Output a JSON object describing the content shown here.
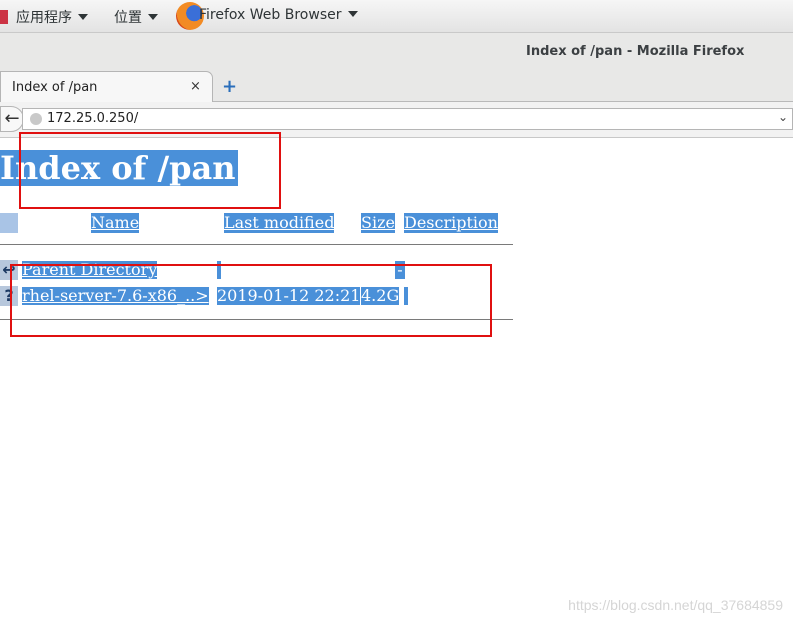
{
  "topbar": {
    "applications": "应用程序",
    "places": "位置",
    "app_name": "Firefox Web Browser"
  },
  "window": {
    "title": "Index of /pan - Mozilla Firefox"
  },
  "tab": {
    "label": "Index of /pan",
    "close": "×",
    "new_tab": "+"
  },
  "navbar": {
    "back": "←",
    "url": "172.25.0.250/",
    "url_dropdown": "⌄"
  },
  "page": {
    "heading": "Index of /pan",
    "columns": [
      "Name",
      "Last modified",
      "Size",
      "Description"
    ],
    "rows": [
      {
        "icon": "↩",
        "icon_name": "back-folder-icon",
        "name": "Parent Directory",
        "modified": "",
        "size": "-",
        "description": ""
      },
      {
        "icon": "?",
        "icon_name": "unknown-file-icon",
        "name": "rhel-server-7.6-x86_..>",
        "modified": "2019-01-12 22:21",
        "size": "4.2G",
        "description": ""
      }
    ]
  },
  "watermark": "https://blog.csdn.net/qq_37684859",
  "colors": {
    "selection": "#4a90d9",
    "annotation": "#e01010"
  }
}
